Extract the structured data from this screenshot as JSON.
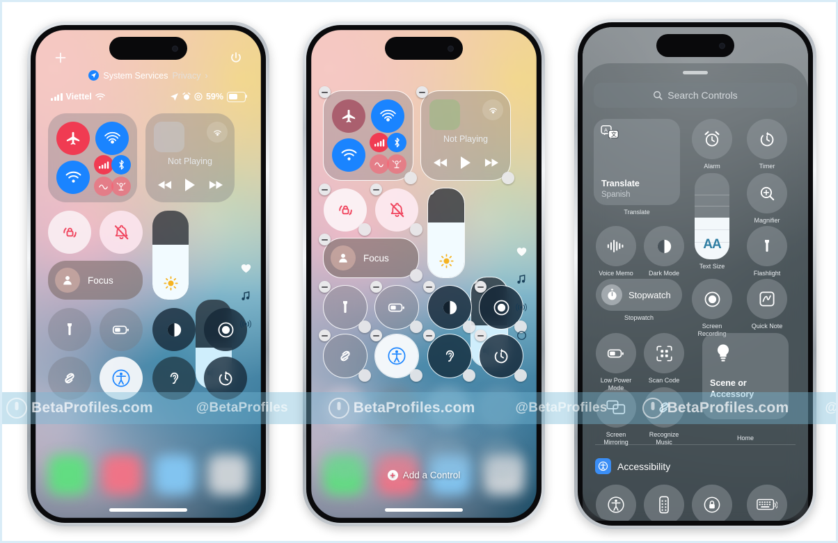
{
  "watermark": {
    "segments": [
      "BetaProfiles.com",
      "@BetaProfiles",
      "BetaProfiles.com",
      "@BetaProfiles",
      "BetaProfiles.com",
      "@BetaP"
    ],
    "band_color": "#76bad6"
  },
  "phone1": {
    "name": "Control Center",
    "top_left_icon": "plus-icon",
    "top_right_icon": "power-icon",
    "privacy": {
      "icon": "location-arrow-icon",
      "label": "System Services",
      "link": "Privacy",
      "chevron": "›"
    },
    "status": {
      "carrier": "Viettel",
      "wifi_icon": "wifi-icon",
      "signal_icon": "cellular-bars-icon",
      "location_icon": "location-arrow-icon",
      "alarm_icon": "alarm-clock-icon",
      "focus_icon": "focus-circle-icon",
      "battery_percent": "59%",
      "battery_icon": "battery-icon"
    },
    "connectivity": {
      "airplane": "airplane-mode-icon",
      "airdrop": "airdrop-icon",
      "wifi": "wifi-icon",
      "cellular": "cellular-data-icon",
      "bluetooth": "bluetooth-icon",
      "vpn": "vpn-icon",
      "satellite": "satellite-icon"
    },
    "media": {
      "title": "Not Playing",
      "airplay_icon": "airplay-audio-icon",
      "prev": "rewind-icon",
      "play": "play-icon",
      "next": "fast-forward-icon"
    },
    "toggles": {
      "rotation_lock": "rotation-lock-icon",
      "silent_mode": "bell-slash-icon",
      "focus_label": "Focus",
      "focus_icon": "person-icon",
      "flashlight": "flashlight-icon",
      "low_power": "low-power-battery-icon",
      "dark_mode": "dark-mode-icon",
      "screen_record": "screen-record-icon",
      "shazam": "shazam-icon",
      "accessibility": "accessibility-icon",
      "hearing": "ear-hearing-icon",
      "timer": "timer-icon"
    },
    "sliders": {
      "brightness_icon": "brightness-sun-icon",
      "brightness_level": 62,
      "volume_icon": "speaker-wave-icon",
      "volume_level": 46
    },
    "side_icons": [
      "heart-icon",
      "music-note-icon",
      "connectivity-waves-icon"
    ],
    "dock_colors": [
      "#5ee07f",
      "#f57285",
      "#84c8f5",
      "#d2d6da"
    ]
  },
  "phone2": {
    "name": "Control Center Edit Mode",
    "edit_mode": true,
    "remove_badge": "minus-badge-icon",
    "resize_handle": "resize-handle-icon",
    "media": {
      "title": "Not Playing"
    },
    "toggles": {
      "focus_label": "Focus"
    },
    "add_control": {
      "icon": "plus-circle-icon",
      "label": "Add a Control"
    },
    "side_icons": [
      "heart-icon",
      "music-note-icon",
      "connectivity-waves-icon",
      "ring-icon"
    ],
    "dock_colors": [
      "#5ee07f",
      "#f57285",
      "#84c8f5",
      "#d2d6da"
    ]
  },
  "phone3": {
    "name": "Controls Gallery",
    "search": {
      "placeholder": "Search Controls",
      "icon": "search-icon"
    },
    "gallery": [
      {
        "id": "translate",
        "label": "Translate",
        "widget": true,
        "title": "Translate",
        "subtitle": "Spanish",
        "icon": "translate-icon"
      },
      {
        "id": "alarm",
        "label": "Alarm",
        "widget": false,
        "icon": "alarm-clock-icon"
      },
      {
        "id": "timer",
        "label": "Timer",
        "widget": false,
        "icon": "timer-icon"
      },
      {
        "id": "text-size",
        "label": "Text Size",
        "widget": false,
        "icon": "text-size-icon"
      },
      {
        "id": "magnifier",
        "label": "Magnifier",
        "widget": false,
        "icon": "magnifier-icon"
      },
      {
        "id": "voice-memo",
        "label": "Voice Memo",
        "widget": false,
        "icon": "voice-memo-icon"
      },
      {
        "id": "dark-mode",
        "label": "Dark Mode",
        "widget": false,
        "icon": "dark-mode-icon"
      },
      {
        "id": "flashlight",
        "label": "Flashlight",
        "widget": false,
        "icon": "flashlight-icon"
      },
      {
        "id": "stopwatch",
        "label": "Stopwatch",
        "widget": true,
        "title": "Stopwatch",
        "icon": "stopwatch-icon"
      },
      {
        "id": "screen-recording",
        "label": "Screen Recording",
        "widget": false,
        "icon": "screen-record-icon"
      },
      {
        "id": "quick-note",
        "label": "Quick Note",
        "widget": false,
        "icon": "quick-note-icon"
      },
      {
        "id": "low-power-mode",
        "label": "Low Power Mode",
        "widget": false,
        "icon": "low-power-battery-icon"
      },
      {
        "id": "scan-code",
        "label": "Scan Code",
        "widget": false,
        "icon": "scan-code-icon"
      },
      {
        "id": "home",
        "label": "Home",
        "widget": true,
        "title": "Scene or Accessory",
        "icon": "lightbulb-icon"
      },
      {
        "id": "screen-mirroring",
        "label": "Screen Mirroring",
        "widget": false,
        "icon": "screen-mirroring-icon"
      },
      {
        "id": "recognize-music",
        "label": "Recognize Music",
        "widget": false,
        "icon": "shazam-icon"
      }
    ],
    "section": {
      "label": "Accessibility",
      "icon": "accessibility-badge-icon",
      "color": "#3b8ef5"
    },
    "section_items": [
      {
        "id": "accessibility-shortcuts",
        "icon": "accessibility-icon"
      },
      {
        "id": "assistive-access",
        "icon": "remote-icon"
      },
      {
        "id": "guided-access",
        "icon": "lock-circle-icon"
      },
      {
        "id": "keyboard",
        "icon": "keyboard-icon"
      }
    ]
  }
}
